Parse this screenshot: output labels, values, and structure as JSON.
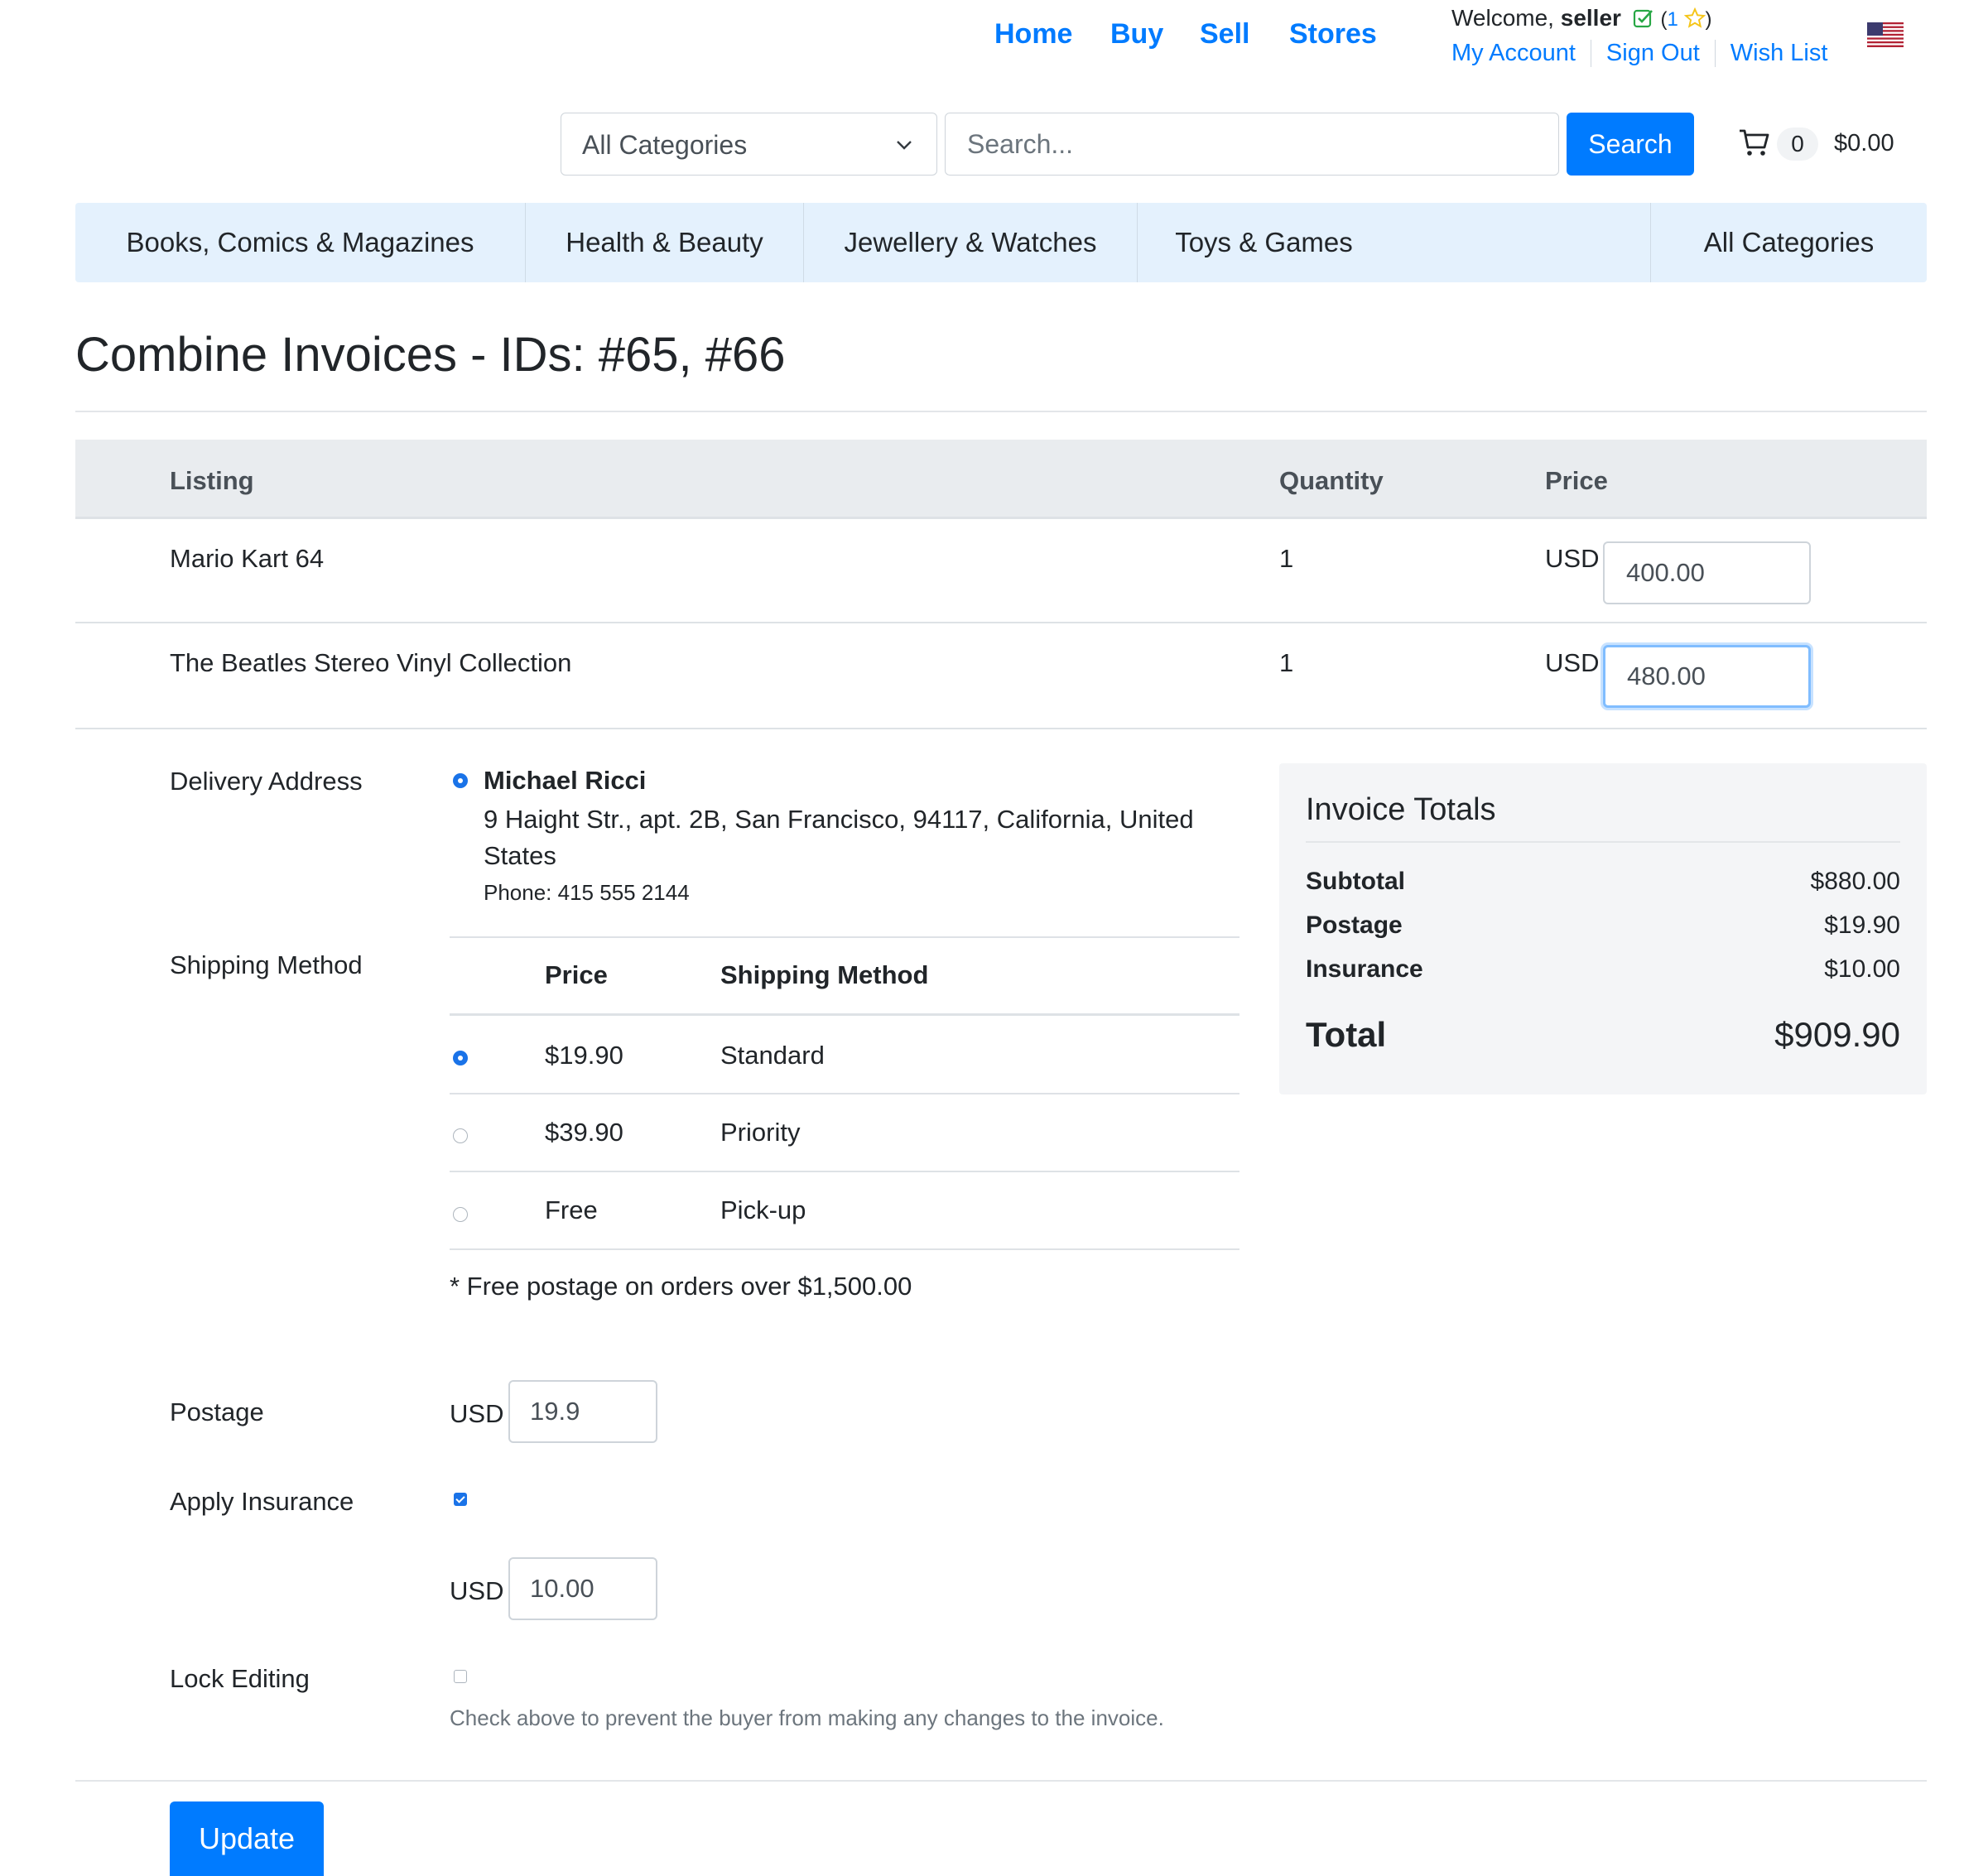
{
  "nav": {
    "links": [
      "Home",
      "Buy",
      "Sell",
      "Stores"
    ],
    "welcome_prefix": "Welcome,",
    "username": "seller",
    "feedback_open": "(",
    "feedback_count": "1",
    "feedback_close": ")",
    "account_links": [
      "My Account",
      "Sign Out",
      "Wish List"
    ],
    "flag_icon": "us-flag-icon"
  },
  "search": {
    "category_selected": "All Categories",
    "placeholder": "Search...",
    "button_label": "Search",
    "cart_count": "0",
    "cart_total": "$0.00"
  },
  "categories": [
    "Books, Comics & Magazines",
    "Health & Beauty",
    "Jewellery & Watches",
    "Toys & Games",
    "All Categories"
  ],
  "page": {
    "title": "Combine Invoices - IDs: #65, #66"
  },
  "listings": {
    "headers": {
      "listing": "Listing",
      "quantity": "Quantity",
      "price": "Price"
    },
    "rows": [
      {
        "name": "Mario Kart 64",
        "quantity": "1",
        "currency": "USD",
        "price": "400.00"
      },
      {
        "name": "The Beatles Stereo Vinyl Collection",
        "quantity": "1",
        "currency": "USD",
        "price": "480.00"
      }
    ]
  },
  "delivery": {
    "label": "Delivery Address",
    "name": "Michael Ricci",
    "address": "9 Haight Str., apt. 2B, San Francisco, 94117, California, United States",
    "phone": "Phone: 415 555 2144"
  },
  "shipping": {
    "label": "Shipping Method",
    "headers": {
      "price": "Price",
      "method": "Shipping Method"
    },
    "options": [
      {
        "price": "$19.90",
        "method": "Standard",
        "selected": true
      },
      {
        "price": "$39.90",
        "method": "Priority",
        "selected": false
      },
      {
        "price": "Free",
        "method": "Pick-up",
        "selected": false
      }
    ],
    "note": "* Free postage on orders over $1,500.00"
  },
  "postage": {
    "label": "Postage",
    "currency": "USD",
    "value": "19.9"
  },
  "insurance": {
    "label": "Apply Insurance",
    "checked": true,
    "currency": "USD",
    "value": "10.00"
  },
  "lock": {
    "label": "Lock Editing",
    "checked": false,
    "help": "Check above to prevent the buyer from making any changes to the invoice."
  },
  "totals": {
    "title": "Invoice Totals",
    "rows": [
      {
        "label": "Subtotal",
        "value": "$880.00"
      },
      {
        "label": "Postage",
        "value": "$19.90"
      },
      {
        "label": "Insurance",
        "value": "$10.00"
      }
    ],
    "total_label": "Total",
    "total_value": "$909.90"
  },
  "actions": {
    "update_label": "Update"
  },
  "colors": {
    "accent": "#007bff",
    "category_bar": "#e4f1fd",
    "star": "#f5c518",
    "check": "#28a745"
  }
}
